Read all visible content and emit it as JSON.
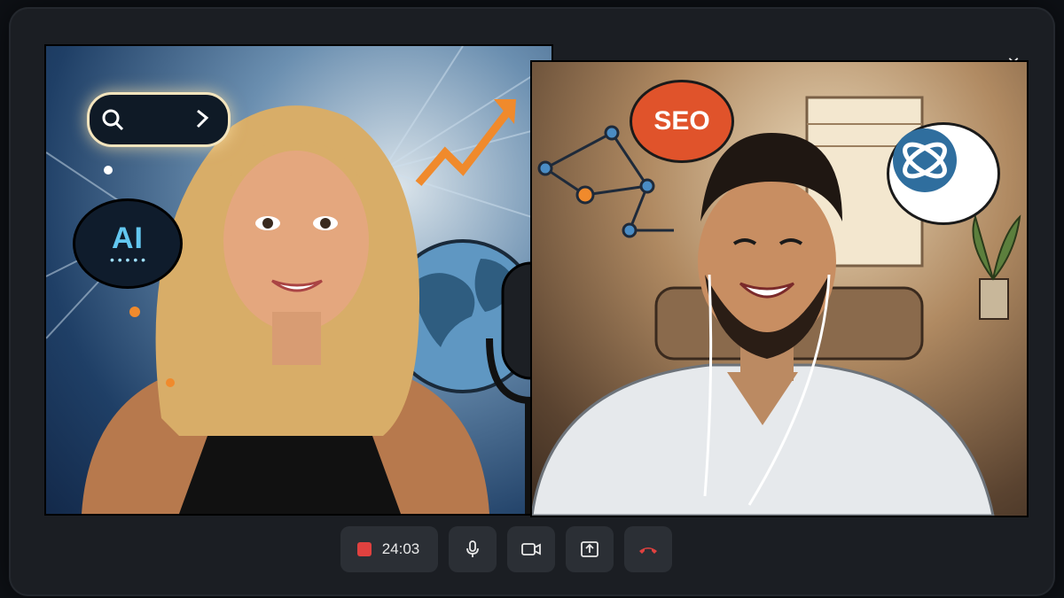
{
  "window": {
    "close_label": "✕"
  },
  "left_tile": {
    "bubble_text": "AI",
    "bubble_dots": "• • • • •"
  },
  "right_tile": {
    "bubble_text": "SEO"
  },
  "controls": {
    "timer": "24:03",
    "record_color": "#e0413f",
    "end_call_color": "#e0413f",
    "icons": [
      "record-icon",
      "microphone-icon",
      "camera-icon",
      "share-screen-icon",
      "end-call-icon"
    ]
  },
  "colors": {
    "frame": "#1b1e23",
    "control_bg": "#2b2f35",
    "seo_bubble": "#e0532b",
    "ai_text": "#63c7f0",
    "logo_blue": "#2f6e9e"
  }
}
